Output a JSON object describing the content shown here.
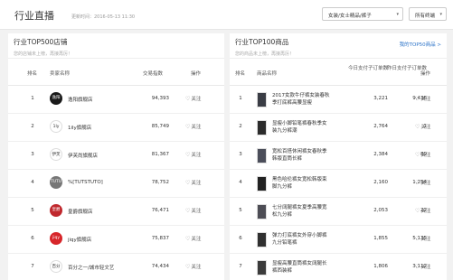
{
  "header": {
    "title": "行业直播",
    "update_time": "更新时间：2016-05-13 11:30",
    "category_select": "女装/女士精品/裤子",
    "terminal_select": "所有终端"
  },
  "shops_panel": {
    "title": "行业TOP500店铺",
    "subtitle": "您的店铺未上榜，再接再厉！",
    "columns": [
      "排名",
      "卖家名称",
      "交易指数",
      "操作"
    ],
    "rows": [
      {
        "rank": "1",
        "logo_text": "逸阳",
        "name": "逸阳旗舰店",
        "index": "94,393",
        "follow": "关注",
        "logo_color": "#1a1a1a"
      },
      {
        "rank": "2",
        "logo_text": "1ly",
        "name": "1ily旗舰店",
        "index": "85,749",
        "follow": "关注",
        "logo_color": "#ffffff"
      },
      {
        "rank": "3",
        "logo_text": "伊芙",
        "name": "伊芙尚旗舰店",
        "index": "81,367",
        "follow": "关注",
        "logo_color": "#ffffff"
      },
      {
        "rank": "4",
        "logo_text": "TUTU",
        "name": "%[TUTSTUTO]",
        "index": "78,752",
        "follow": "关注",
        "logo_color": "#777777"
      },
      {
        "rank": "5",
        "logo_text": "皇爵",
        "name": "皇爵旗舰店",
        "index": "76,471",
        "follow": "关注",
        "logo_color": "#c0282d"
      },
      {
        "rank": "6",
        "logo_text": "jiqy",
        "name": "jiqy旗舰店",
        "index": "75,837",
        "follow": "关注",
        "logo_color": "#d7262a"
      },
      {
        "rank": "7",
        "logo_text": "百分",
        "name": "百分之一/城市轻文艺",
        "index": "74,434",
        "follow": "关注",
        "logo_color": "#ffffff"
      }
    ]
  },
  "products_panel": {
    "title": "行业TOP100商品",
    "subtitle": "您的商品未上榜，再接再厉！",
    "link": "我的TOP50商品 >",
    "columns": [
      "排名",
      "商品名称",
      "今日支付子订单数",
      "昨日支付子订单数",
      "操作"
    ],
    "rows": [
      {
        "rank": "1",
        "name": "2017女款牛仔裤女装春秋季打底裤高腰显瘦",
        "today": "3,221",
        "yesterday": "9,436",
        "follow": "关注"
      },
      {
        "rank": "2",
        "name": "显瘦小脚铅笔裤春秋季女装九分裤潮",
        "today": "2,764",
        "yesterday": "1",
        "follow": "关注"
      },
      {
        "rank": "3",
        "name": "宽松百搭休闲裤女春秋季韩版直筒长裤",
        "today": "2,384",
        "yesterday": "89",
        "follow": "关注"
      },
      {
        "rank": "4",
        "name": "黑色哈伦裤女宽松韩版束脚九分裤",
        "today": "2,160",
        "yesterday": "1,254",
        "follow": "关注"
      },
      {
        "rank": "5",
        "name": "七分阔腿裤女夏季高腰宽松九分裤",
        "today": "2,053",
        "yesterday": "22",
        "follow": "关注"
      },
      {
        "rank": "6",
        "name": "弹力打底裤女外穿小脚裤九分铅笔裤",
        "today": "1,855",
        "yesterday": "5,135",
        "follow": "关注"
      },
      {
        "rank": "7",
        "name": "显瘦高腰直筒裤女阔腿长裤西装裤",
        "today": "1,806",
        "yesterday": "3,112",
        "follow": "关注"
      }
    ]
  }
}
